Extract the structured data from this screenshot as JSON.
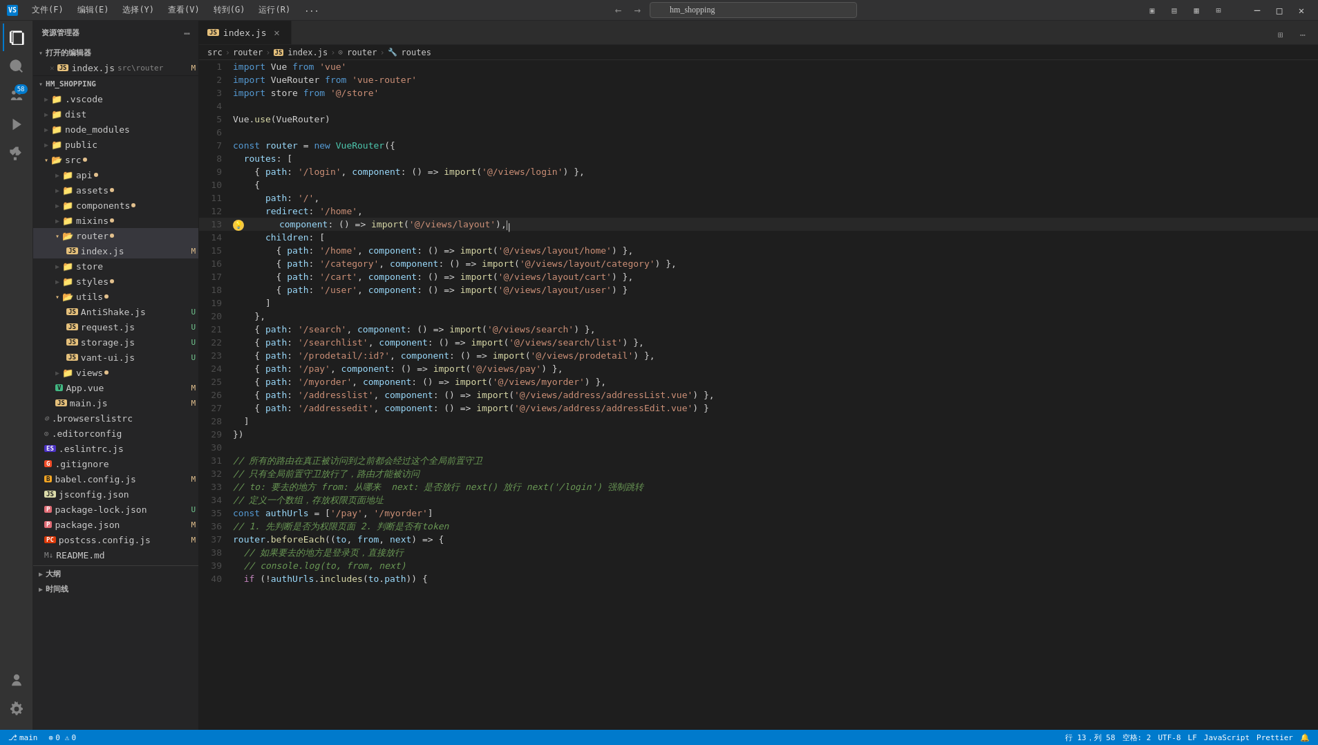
{
  "titleBar": {
    "menuItems": [
      "文件(F)",
      "编辑(E)",
      "选择(Y)",
      "查看(V)",
      "转到(G)",
      "运行(R)",
      "..."
    ],
    "searchPlaceholder": "hm_shopping",
    "windowControls": {
      "minimize": "─",
      "maximize": "□",
      "close": "✕"
    }
  },
  "activityBar": {
    "icons": [
      {
        "name": "explorer-icon",
        "symbol": "⊞",
        "active": true
      },
      {
        "name": "search-icon",
        "symbol": "🔍"
      },
      {
        "name": "source-control-icon",
        "symbol": "⑂",
        "badge": "58"
      },
      {
        "name": "run-icon",
        "symbol": "▷"
      },
      {
        "name": "extensions-icon",
        "symbol": "⊞"
      }
    ],
    "bottomIcons": [
      {
        "name": "account-icon",
        "symbol": "👤"
      },
      {
        "name": "settings-icon",
        "symbol": "⚙"
      }
    ]
  },
  "sidebar": {
    "title": "资源管理器",
    "openEditors": {
      "label": "打开的编辑器",
      "items": [
        {
          "icon": "JS",
          "name": "index.js",
          "path": "src\\router",
          "badge": "M"
        }
      ]
    },
    "project": {
      "label": "HM_SHOPPING",
      "items": [
        {
          "indent": 1,
          "icon": "folder",
          "name": ".vscode",
          "type": "folder"
        },
        {
          "indent": 1,
          "icon": "folder",
          "name": "dist",
          "type": "folder"
        },
        {
          "indent": 1,
          "icon": "folder",
          "name": "node_modules",
          "type": "folder"
        },
        {
          "indent": 1,
          "icon": "folder",
          "name": "public",
          "type": "folder"
        },
        {
          "indent": 1,
          "icon": "folder-open",
          "name": "src",
          "type": "folder-open",
          "badge": "dot"
        },
        {
          "indent": 2,
          "icon": "folder",
          "name": "api",
          "type": "folder",
          "badge": "dot"
        },
        {
          "indent": 2,
          "icon": "folder",
          "name": "assets",
          "type": "folder",
          "badge": "dot"
        },
        {
          "indent": 2,
          "icon": "folder",
          "name": "components",
          "type": "folder",
          "badge": "dot"
        },
        {
          "indent": 2,
          "icon": "folder",
          "name": "mixins",
          "type": "folder",
          "badge": "dot"
        },
        {
          "indent": 2,
          "icon": "folder-open",
          "name": "router",
          "type": "folder-open",
          "badge": "dot",
          "active": true
        },
        {
          "indent": 3,
          "icon": "JS",
          "name": "index.js",
          "type": "js",
          "badge": "M"
        },
        {
          "indent": 2,
          "icon": "folder",
          "name": "store",
          "type": "folder"
        },
        {
          "indent": 2,
          "icon": "folder",
          "name": "styles",
          "type": "folder",
          "badge": "dot"
        },
        {
          "indent": 2,
          "icon": "folder",
          "name": "utils",
          "type": "folder",
          "badge": "dot"
        },
        {
          "indent": 3,
          "icon": "JS",
          "name": "AntiShake.js",
          "type": "js",
          "badge": "U"
        },
        {
          "indent": 3,
          "icon": "JS",
          "name": "request.js",
          "type": "js",
          "badge": "U"
        },
        {
          "indent": 3,
          "icon": "JS",
          "name": "storage.js",
          "type": "js",
          "badge": "U"
        },
        {
          "indent": 3,
          "icon": "JS",
          "name": "vant-ui.js",
          "type": "js",
          "badge": "U"
        },
        {
          "indent": 2,
          "icon": "folder",
          "name": "views",
          "type": "folder",
          "badge": "dot"
        },
        {
          "indent": 2,
          "icon": "vue",
          "name": "App.vue",
          "type": "vue",
          "badge": "M"
        },
        {
          "indent": 2,
          "icon": "JS",
          "name": "main.js",
          "type": "js",
          "badge": "M"
        },
        {
          "indent": 1,
          "icon": "browserslist",
          "name": ".browserslistrc",
          "type": "config"
        },
        {
          "indent": 1,
          "icon": "editor",
          "name": ".editorconfig",
          "type": "config"
        },
        {
          "indent": 1,
          "icon": "eslint",
          "name": ".eslintrc.js",
          "type": "js"
        },
        {
          "indent": 1,
          "icon": "git",
          "name": ".gitignore",
          "type": "config"
        },
        {
          "indent": 1,
          "icon": "babel",
          "name": "babel.config.js",
          "type": "js",
          "badge": "M"
        },
        {
          "indent": 1,
          "icon": "JSON",
          "name": "jsconfig.json",
          "type": "json"
        },
        {
          "indent": 1,
          "icon": "pkg-lock",
          "name": "package-lock.json",
          "type": "json",
          "badge": "U"
        },
        {
          "indent": 1,
          "icon": "pkg",
          "name": "package.json",
          "type": "json",
          "badge": "M"
        },
        {
          "indent": 1,
          "icon": "postcss",
          "name": "postcss.config.js",
          "type": "js",
          "badge": "M"
        },
        {
          "indent": 1,
          "icon": "md",
          "name": "README.md",
          "type": "md"
        }
      ]
    }
  },
  "bottomSections": [
    {
      "label": "大纲"
    },
    {
      "label": "时间线"
    }
  ],
  "tabs": [
    {
      "icon": "JS",
      "name": "index.js",
      "active": true,
      "modified": true
    }
  ],
  "breadcrumb": {
    "items": [
      "src",
      "router",
      "JS index.js",
      "router",
      "routes"
    ]
  },
  "editor": {
    "filename": "index.js",
    "lines": [
      {
        "num": 1,
        "code": "<kw>import</kw> Vue <kw>from</kw> <str>'vue'</str>"
      },
      {
        "num": 2,
        "code": "<kw>import</kw> VueRouter <kw>from</kw> <str>'vue-router'</str>"
      },
      {
        "num": 3,
        "code": "<kw>import</kw> store <kw>from</kw> <str>'@/store'</str>"
      },
      {
        "num": 4,
        "code": ""
      },
      {
        "num": 5,
        "code": "Vue.<fn>use</fn>(VueRouter)"
      },
      {
        "num": 6,
        "code": ""
      },
      {
        "num": 7,
        "code": "<kw>const</kw> <var>router</var> = <kw>new</kw> <cls>VueRouter</cls>({"
      },
      {
        "num": 8,
        "code": "  routes: ["
      },
      {
        "num": 9,
        "code": "    { path: <str>'/login'</str>, component: () => <fn>import</fn>(<str>'@/views/login'</str>) },"
      },
      {
        "num": 10,
        "code": "    {"
      },
      {
        "num": 11,
        "code": "      path: <str>'/'</str>,"
      },
      {
        "num": 12,
        "code": "      redirect: <str>'/home'</str>,"
      },
      {
        "num": 13,
        "code": "      component: () => <fn>import</fn>(<str>'@/views/layout'</str>),|",
        "hint": true
      },
      {
        "num": 14,
        "code": "      children: ["
      },
      {
        "num": 15,
        "code": "        { path: <str>'/home'</str>, component: () => <fn>import</fn>(<str>'@/views/layout/home'</str>) },"
      },
      {
        "num": 16,
        "code": "        { path: <str>'/category'</str>, component: () => <fn>import</fn>(<str>'@/views/layout/category'</str>) },"
      },
      {
        "num": 17,
        "code": "        { path: <str>'/cart'</str>, component: () => <fn>import</fn>(<str>'@/views/layout/cart'</str>) },"
      },
      {
        "num": 18,
        "code": "        { path: <str>'/user'</str>, component: () => <fn>import</fn>(<str>'@/views/layout/user'</str>) }"
      },
      {
        "num": 19,
        "code": "      ]"
      },
      {
        "num": 20,
        "code": "    },"
      },
      {
        "num": 21,
        "code": "    { path: <str>'/search'</str>, component: () => <fn>import</fn>(<str>'@/views/search'</str>) },"
      },
      {
        "num": 22,
        "code": "    { path: <str>'/searchlist'</str>, component: () => <fn>import</fn>(<str>'@/views/search/list'</str>) },"
      },
      {
        "num": 23,
        "code": "    { path: <str>'/prodetail/:id?'</str>, component: () => <fn>import</fn>(<str>'@/views/prodetail'</str>) },"
      },
      {
        "num": 24,
        "code": "    { path: <str>'/pay'</str>, component: () => <fn>import</fn>(<str>'@/views/pay'</str>) },"
      },
      {
        "num": 25,
        "code": "    { path: <str>'/myorder'</str>, component: () => <fn>import</fn>(<str>'@/views/myorder'</str>) },"
      },
      {
        "num": 26,
        "code": "    { path: <str>'/addresslist'</str>, component: () => <fn>import</fn>(<str>'@/views/address/addressList.vue'</str>) },"
      },
      {
        "num": 27,
        "code": "    { path: <str>'/addressedit'</str>, component: () => <fn>import</fn>(<str>'@/views/address/addressEdit.vue'</str>) }"
      },
      {
        "num": 28,
        "code": "  ]"
      },
      {
        "num": 29,
        "code": "})"
      },
      {
        "num": 30,
        "code": ""
      },
      {
        "num": 31,
        "code": "<cm>// 所有的路由在真正被访问到之前都会经过这个全局前置守卫</cm>"
      },
      {
        "num": 32,
        "code": "<cm>// 只有全局前置守卫放行了，路由才能被访问</cm>"
      },
      {
        "num": 33,
        "code": "<cm>// to: 要去的地方 from: 从哪来  next: 是否放行 next() 放行 next('/login') 强制跳转</cm>"
      },
      {
        "num": 34,
        "code": "<cm>// 定义一个数组，存放权限页面地址</cm>"
      },
      {
        "num": 35,
        "code": "<kw>const</kw> <var>authUrls</var> = [<str>'/pay'</str>, <str>'/myorder'</str>]"
      },
      {
        "num": 36,
        "code": "<cm>// 1. 先判断是否为权限页面 2. 判断是否有token</cm>"
      },
      {
        "num": 37,
        "code": "<var>router</var>.<fn>beforeEach</fn>((<var>to</var>, <var>from</var>, <var>next</var>) => {"
      },
      {
        "num": 38,
        "code": "  <cm>// 如果要去的地方是登录页，直接放行</cm>"
      },
      {
        "num": 39,
        "code": "  <cm>// console.log(to, from, next)</cm>"
      },
      {
        "num": 40,
        "code": "  <kw2>if</kw2> (!<var>authUrls</var>.<fn>includes</fn>(<var>to</var>.<prop>path</prop>)) {"
      }
    ]
  },
  "statusBar": {
    "left": [
      {
        "name": "git-branch",
        "text": "⑂ main"
      },
      {
        "name": "errors",
        "text": "⊗ 0  ⚠ 0"
      }
    ],
    "right": [
      {
        "name": "line-col",
        "text": "行 13，列 58"
      },
      {
        "name": "spaces",
        "text": "空格: 2"
      },
      {
        "name": "encoding",
        "text": "UTF-8"
      },
      {
        "name": "line-ending",
        "text": "LF"
      },
      {
        "name": "language",
        "text": "JavaScript"
      },
      {
        "name": "prettier",
        "text": "Prettier"
      },
      {
        "name": "feedback",
        "text": "🔔"
      }
    ]
  }
}
